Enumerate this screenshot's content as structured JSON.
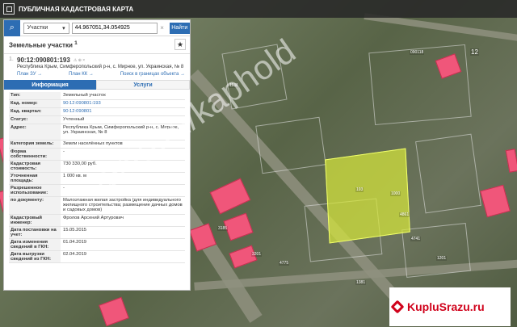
{
  "app": {
    "title": "ПУБЛИЧНАЯ КАДАСТРОВАЯ КАРТА"
  },
  "search": {
    "type_label": "Участки",
    "value": "44.967051,34.054925",
    "button_label": "Найти",
    "search_icon": "search-icon"
  },
  "results": {
    "title": "Земельные участки",
    "count": "1",
    "item_index": "1.",
    "code": "90:12:090801:193",
    "address": "Республика Крым, Симферопольский р-н, с. Мирное, ул. Украинская, № 8",
    "link_plan": "План ЗУ →",
    "link_kk": "План КК →",
    "link_search": "Поиск в границах объекта →"
  },
  "tabs": {
    "info": "Информация",
    "services": "Услуги"
  },
  "attributes": [
    {
      "key": "Тип:",
      "value": "Земельный участок"
    },
    {
      "key": "Кад. номер:",
      "value": "90:12:090801:193"
    },
    {
      "key": "Кад. квартал:",
      "value": "90:12:090801"
    },
    {
      "key": "Статус:",
      "value": "Учтенный"
    },
    {
      "key": "Адрес:",
      "value": "Республика Крым, Симферопольский р-н, с. Мирное, ул. Украинская, № 8"
    },
    {
      "key": "Категория земель:",
      "value": "Земли населённых пунктов"
    },
    {
      "key": "Форма собственности:",
      "value": "-"
    },
    {
      "key": "Кадастровая стоимость:",
      "value": "730 330,00 руб."
    },
    {
      "key": "Уточненная площадь:",
      "value": "1 000 кв. м"
    },
    {
      "key": "Разрешенное использование:",
      "value": "-"
    },
    {
      "key": "по документу:",
      "value": "Малоэтажная жилая застройка (для индивидуального жилищного строительства; размещение дачных домов и садовых домов)"
    },
    {
      "key": "Кадастровый инженер:",
      "value": "Фролов Арсений Артурович"
    },
    {
      "key": "Дата постановки на учет:",
      "value": "15.05.2015"
    },
    {
      "key": "Дата изменения сведений в ГКН:",
      "value": "01.04.2019"
    },
    {
      "key": "Дата выгрузки сведений из ГКН:",
      "value": "02.04.2019"
    }
  ],
  "map_labels": {
    "parcel_193": "193",
    "parcel_area": "1000",
    "parcel_num_right": "4861",
    "top_code": "090118",
    "top_num": "12",
    "left_code": "1138",
    "mid_a": "4741",
    "mid_b": "4775",
    "mid_c": "3201",
    "mid_d": "3185",
    "bot_a": "1201",
    "bot_b": "1381"
  },
  "watermark": "avito.ru/kaphold",
  "brand": {
    "name": "KupluSrazu.ru",
    "color": "#d0021b"
  }
}
